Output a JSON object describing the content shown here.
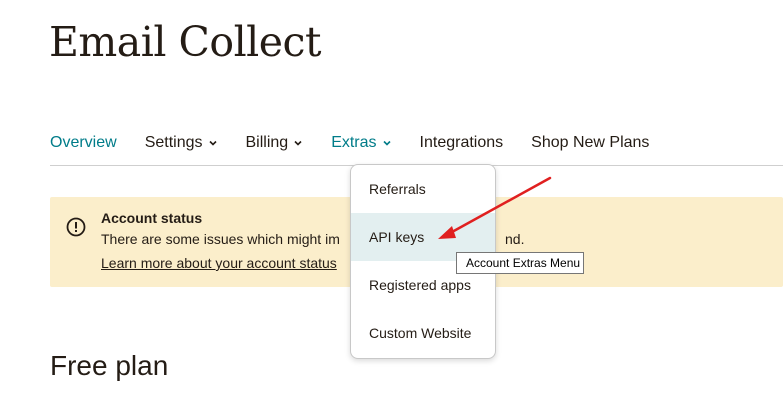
{
  "page": {
    "title": "Email Collect",
    "section_heading": "Free plan"
  },
  "nav": {
    "items": [
      {
        "label": "Overview",
        "has_chevron": false
      },
      {
        "label": "Settings",
        "has_chevron": true
      },
      {
        "label": "Billing",
        "has_chevron": true
      },
      {
        "label": "Extras",
        "has_chevron": true
      },
      {
        "label": "Integrations",
        "has_chevron": false
      },
      {
        "label": "Shop New Plans",
        "has_chevron": false
      }
    ]
  },
  "alert": {
    "icon": "exclamation-circle-icon",
    "title": "Account status",
    "text": "There are some issues which might im",
    "text_tail": "nd.",
    "link": "Learn more about your account status"
  },
  "extras_menu": {
    "items": [
      {
        "label": "Referrals"
      },
      {
        "label": "API keys"
      },
      {
        "label": "Registered apps"
      },
      {
        "label": "Custom Website"
      }
    ],
    "hovered_item": "API keys"
  },
  "tooltip": {
    "text": "Account Extras Menu"
  },
  "colors": {
    "accent": "#007c89",
    "alert_bg": "#fbeecb",
    "hover_bg": "#e3eff0",
    "annotation_arrow": "#e02020"
  }
}
